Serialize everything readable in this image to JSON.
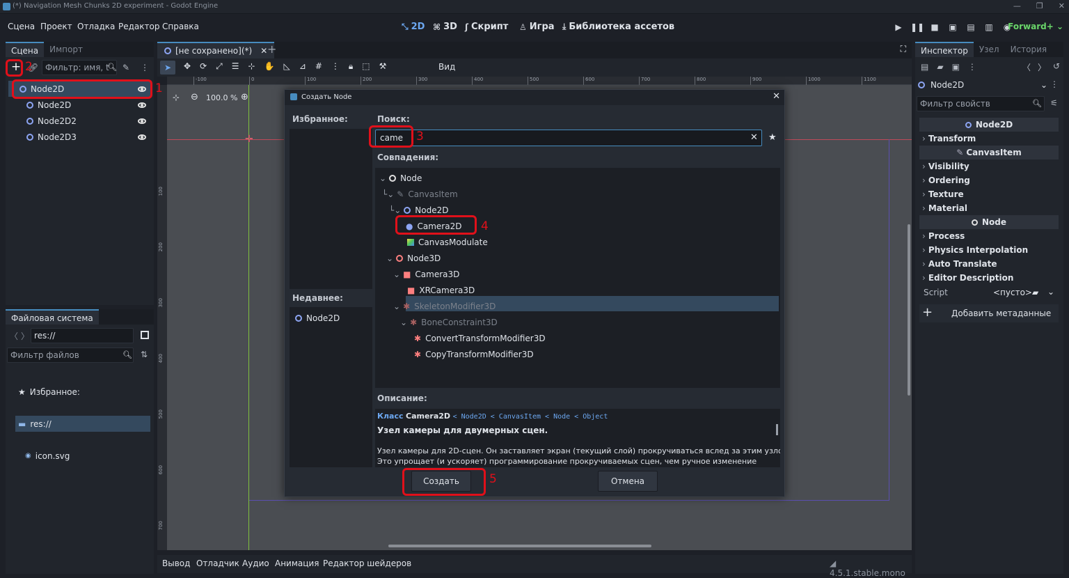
{
  "window": {
    "title": "(*) Navigation Mesh Chunks 2D experiment - Godot Engine"
  },
  "menu": [
    "Сцена",
    "Проект",
    "Отладка",
    "Редактор",
    "Справка"
  ],
  "workspaces": [
    {
      "icon": "2d-icon",
      "label": "2D"
    },
    {
      "icon": "3d-icon",
      "label": "3D"
    },
    {
      "icon": "script-icon",
      "label": "Скрипт"
    },
    {
      "icon": "game-icon",
      "label": "Игра"
    },
    {
      "icon": "assetlib-icon",
      "label": "Библиотека ассетов"
    }
  ],
  "renderer": "Forward+",
  "scene_panel": {
    "tabs": [
      "Сцена",
      "Импорт"
    ],
    "filter_placeholder": "Фильтр: имя, t",
    "nodes": [
      {
        "name": "Node2D",
        "root": true
      },
      {
        "name": "Node2D"
      },
      {
        "name": "Node2D2"
      },
      {
        "name": "Node2D3"
      }
    ]
  },
  "fs_panel": {
    "title": "Файловая система",
    "path": "res://",
    "filter_placeholder": "Фильтр файлов",
    "favorites": "Избранное:",
    "items": [
      "res://",
      "icon.svg"
    ]
  },
  "editor": {
    "tab": "[не сохранено](*)",
    "view": "Вид",
    "zoom": "100.0 %",
    "ruler_h": [
      "-100",
      "0",
      "100",
      "200",
      "300",
      "400",
      "500",
      "600",
      "700",
      "800",
      "900",
      "1000",
      "1100"
    ],
    "ruler_v": [
      "100",
      "200",
      "300",
      "400",
      "500",
      "600",
      "700"
    ]
  },
  "dialog": {
    "title": "Создать Node",
    "favorites": "Избранное:",
    "recent": "Недавнее:",
    "recent_items": [
      "Node2D"
    ],
    "search_label": "Поиск:",
    "search_value": "came",
    "matches": "Совпадения:",
    "tree": [
      {
        "label": "Node",
        "dim": false
      },
      {
        "label": "CanvasItem",
        "dim": true
      },
      {
        "label": "Node2D",
        "dim": false
      },
      {
        "label": "Camera2D",
        "dim": false
      },
      {
        "label": "CanvasModulate",
        "dim": false
      },
      {
        "label": "Node3D",
        "dim": false
      },
      {
        "label": "Camera3D",
        "dim": false
      },
      {
        "label": "XRCamera3D",
        "dim": false
      },
      {
        "label": "SkeletonModifier3D",
        "dim": true
      },
      {
        "label": "BoneConstraint3D",
        "dim": true
      },
      {
        "label": "ConvertTransformModifier3D",
        "dim": false
      },
      {
        "label": "CopyTransformModifier3D",
        "dim": false
      }
    ],
    "desc_label": "Описание:",
    "class_line": {
      "prefix": "Класс",
      "name": "Camera2D",
      "chain": "< Node2D < CanvasItem < Node < Object"
    },
    "desc_title": "Узел камеры для двумерных сцен.",
    "desc_body1": "Узел камеры для 2D-сцен. Он заставляет экран (текущий слой) прокручиваться вслед за этим узлом.",
    "desc_body2": "Это упрощает (и ускоряет) программирование прокручиваемых сцен, чем ручное изменение",
    "create": "Создать",
    "cancel": "Отмена"
  },
  "inspector": {
    "tabs": [
      "Инспектор",
      "Узел",
      "История"
    ],
    "node": "Node2D",
    "filter_placeholder": "Фильтр свойств",
    "sections": [
      {
        "title": "Node2D",
        "items": [
          "Transform"
        ]
      },
      {
        "title": "CanvasItem",
        "items": [
          "Visibility",
          "Ordering",
          "Texture",
          "Material"
        ]
      },
      {
        "title": "Node",
        "items": [
          "Process",
          "Physics Interpolation",
          "Auto Translate",
          "Editor Description"
        ]
      }
    ],
    "script_label": "Script",
    "script_value": "<пусто>",
    "add_meta": "Добавить метаданные"
  },
  "bottom": {
    "tabs": [
      "Вывод",
      "Отладчик",
      "Аудио",
      "Анимация",
      "Редактор шейдеров"
    ],
    "version": "4.5.1.stable.mono"
  },
  "annotations": [
    "1",
    "2",
    "3",
    "4",
    "5"
  ]
}
